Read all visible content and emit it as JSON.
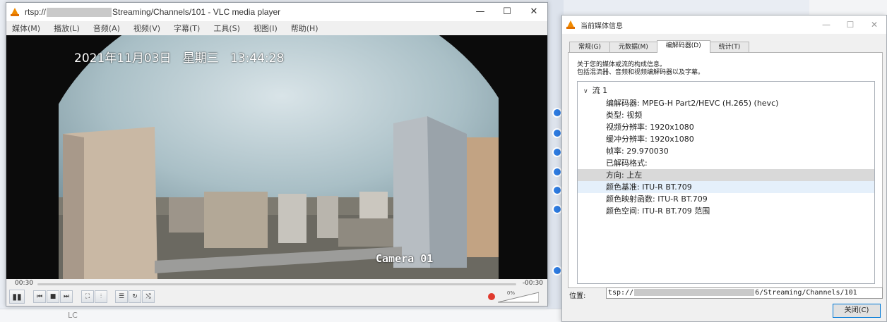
{
  "vlc": {
    "title_prefix": "rtsp://",
    "title_suffix": "Streaming/Channels/101 - VLC media player",
    "window_buttons": [
      "—",
      "☐",
      "✕"
    ],
    "menu": [
      "媒体(M)",
      "播放(L)",
      "音频(A)",
      "视频(V)",
      "字幕(T)",
      "工具(S)",
      "视图(I)",
      "帮助(H)"
    ],
    "osd_timestamp": "2021年11月03日   星期三   13:44:28",
    "osd_camera": "Camera 01",
    "elapsed": "00:30",
    "remaining": "-00:30",
    "volume_percent": "0%",
    "volume_level": 0
  },
  "info": {
    "title": "当前媒体信息",
    "tabs": [
      "常规(G)",
      "元数据(M)",
      "编解码器(D)",
      "统计(T)"
    ],
    "active_tab": 2,
    "description_line1": "关于您的媒体或流的构成信息。",
    "description_line2": "包括混流器、音频和视频编解码器以及字幕。",
    "stream_label": "流 1",
    "rows": [
      "编解码器: MPEG-H Part2/HEVC (H.265) (hevc)",
      "类型: 视频",
      "视频分辨率: 1920x1080",
      "缓冲分辨率: 1920x1080",
      "帧率: 29.970030",
      "已解码格式:",
      "方向: 上左",
      "颜色基准: ITU-R BT.709",
      "颜色映射函数: ITU-R BT.709",
      "颜色空间: ITU-R BT.709 范围"
    ],
    "selected_row": 6,
    "hover_row": 7,
    "location_label": "位置:",
    "location_prefix": "tsp://",
    "location_suffix": "6/Streaming/Channels/101",
    "close_label": "关闭(C)"
  },
  "background": {
    "bottom_text": "LC"
  }
}
